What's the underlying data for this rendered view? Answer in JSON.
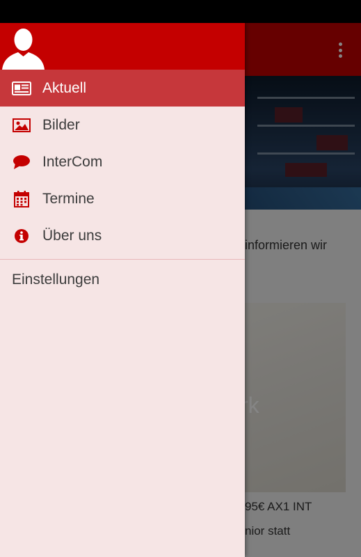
{
  "colors": {
    "accent": "#c40000",
    "drawer_bg": "#f6e5e5",
    "active_item": "#c6373b"
  },
  "drawer": {
    "items": [
      {
        "label": "Aktuell",
        "icon": "newspaper-icon",
        "active": true
      },
      {
        "label": "Bilder",
        "icon": "image-icon",
        "active": false
      },
      {
        "label": "InterCom",
        "icon": "chat-bubble-icon",
        "active": false
      },
      {
        "label": "Termine",
        "icon": "calendar-icon",
        "active": false
      },
      {
        "label": "Über uns",
        "icon": "info-icon",
        "active": false
      }
    ],
    "settings_label": "Einstellungen"
  },
  "background": {
    "intro_text": "informieren wir",
    "intro_text_2": ".",
    "card_title": "rk",
    "card_caption": "95€ AX1 INT",
    "card_caption_2": "nior statt"
  }
}
